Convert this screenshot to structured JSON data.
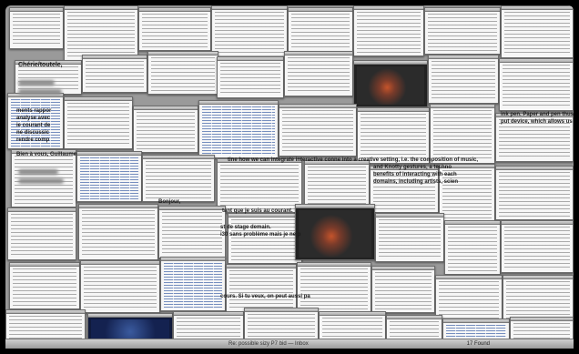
{
  "texts": {
    "chez_heading": "Chérie/toutele,",
    "bien_a_vous": "Bien à vous, Guillaume",
    "bonjour": "Bonjour,",
    "ments_lines": [
      "ments rappor",
      "analyse avec",
      "ie courant de",
      "ne discussic",
      "rendre comp"
    ],
    "tant_que": "tant que je suis au courant.",
    "stage_lines": [
      "st de stage demain.",
      "i30 sans problème mais je ne p"
    ],
    "courant_line": "cours. Si tu veux, on peut aussi pa",
    "interactive_lines": [
      "tine how we can integrate interactive conne into a creative setting, i.e. the composition of music,",
      "and Knotty gestures, a techno",
      "benefits of interacting with each",
      "domains, including artists, scien"
    ],
    "ink_pen_lines": [
      "ink pen. Paper and pen thus beco",
      "put device, which allows us to tr"
    ],
    "found_count": "17 Found",
    "mail_title": "Re: possible sizy P7 bid — Inbox"
  },
  "colors": {
    "background": "#9a9a9a",
    "window": "#f6f6f6",
    "accent_blue": "#3f63a8",
    "dark_window": "#101a3c"
  }
}
